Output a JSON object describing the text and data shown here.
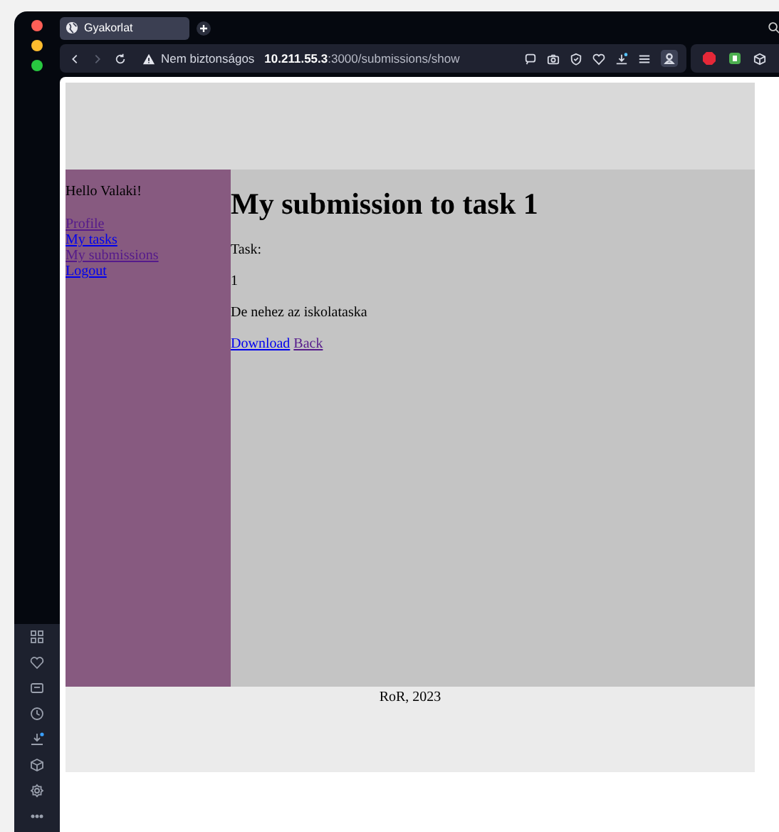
{
  "browser": {
    "tab": {
      "title": "Gyakorlat",
      "selected": true
    },
    "address": {
      "security": "Nem biztonságos",
      "host": "10.211.55.3",
      "path": ":3000/submissions/show"
    }
  },
  "page": {
    "greeting": "Hello Valaki!",
    "nav": [
      {
        "label": "Profile",
        "visited": true
      },
      {
        "label": "My tasks",
        "visited": false
      },
      {
        "label": "My submissions",
        "visited": true
      },
      {
        "label": "Logout",
        "visited": false
      }
    ],
    "title": "My submission to task 1",
    "paragraphs": [
      "Task:",
      "1",
      "De nehez az iskolataska"
    ],
    "links": [
      {
        "label": "Download",
        "visited": false
      },
      {
        "label": "Back",
        "visited": true
      }
    ],
    "footer": "RoR, 2023"
  }
}
